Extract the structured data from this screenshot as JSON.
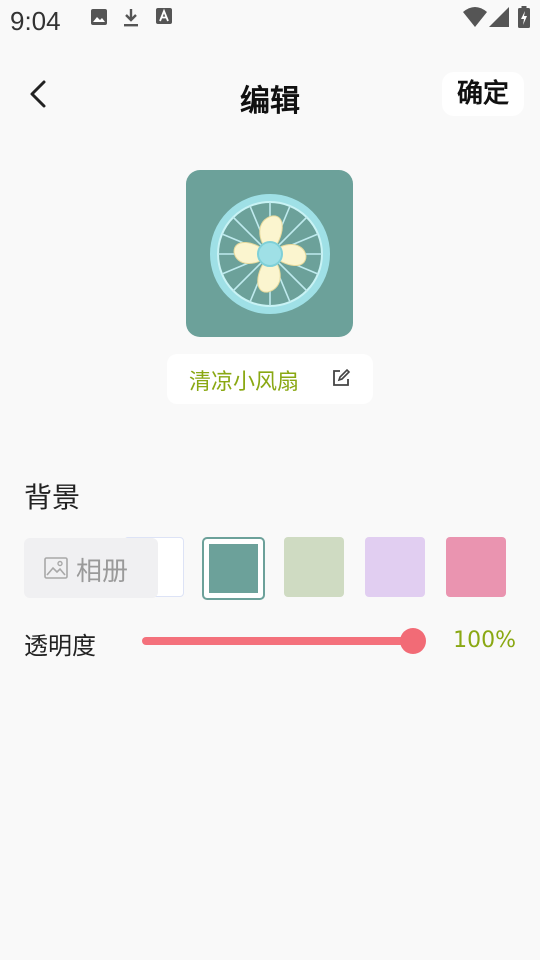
{
  "status_bar": {
    "time": "9:04"
  },
  "header": {
    "title": "编辑",
    "confirm_label": "确定"
  },
  "widget": {
    "name": "清凉小风扇"
  },
  "background_section": {
    "label": "背景",
    "album_label": "相册",
    "swatches": [
      {
        "color": "#ffffff",
        "selected": false
      },
      {
        "color": "#6ca19a",
        "selected": true
      },
      {
        "color": "#cfdbc2",
        "selected": false
      },
      {
        "color": "#e1cef1",
        "selected": false
      },
      {
        "color": "#ea94b0",
        "selected": false
      }
    ]
  },
  "opacity": {
    "label": "透明度",
    "value_text": "100%",
    "value": 1.0
  },
  "colors": {
    "accent_text": "#8aa813",
    "slider": "#f4717c"
  }
}
